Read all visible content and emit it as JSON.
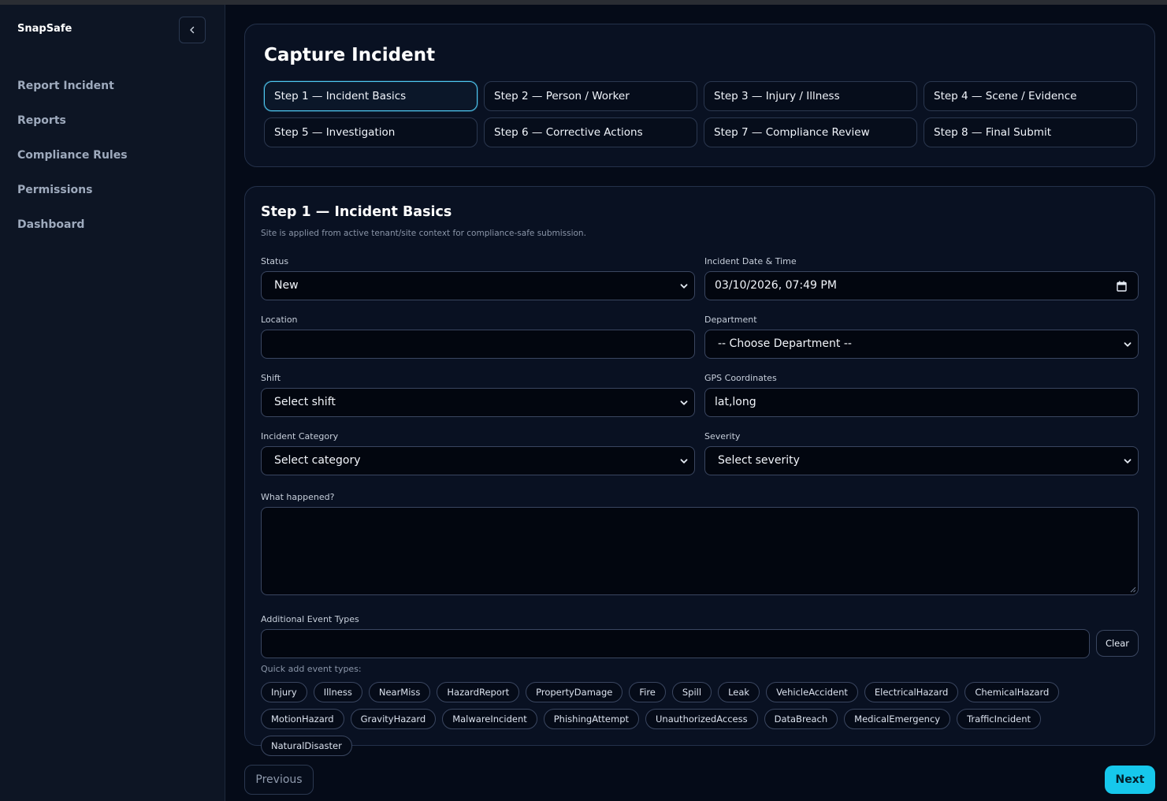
{
  "app": {
    "name": "SnapSafe"
  },
  "sidebar": {
    "items": [
      {
        "label": "Report Incident"
      },
      {
        "label": "Reports"
      },
      {
        "label": "Compliance Rules"
      },
      {
        "label": "Permissions"
      },
      {
        "label": "Dashboard"
      }
    ]
  },
  "page": {
    "title": "Capture Incident"
  },
  "steps": [
    {
      "label": "Step 1 — Incident Basics",
      "active": true
    },
    {
      "label": "Step 2 — Person / Worker"
    },
    {
      "label": "Step 3 — Injury / Illness"
    },
    {
      "label": "Step 4 — Scene / Evidence"
    },
    {
      "label": "Step 5 — Investigation"
    },
    {
      "label": "Step 6 — Corrective Actions"
    },
    {
      "label": "Step 7 — Compliance Review"
    },
    {
      "label": "Step 8 — Final Submit"
    }
  ],
  "form": {
    "title": "Step 1 — Incident Basics",
    "subtitle": "Site is applied from active tenant/site context for compliance-safe submission.",
    "status": {
      "label": "Status",
      "value": "New"
    },
    "datetime": {
      "label": "Incident Date & Time",
      "value": "03/10/2026, 07:49 PM"
    },
    "location": {
      "label": "Location",
      "value": ""
    },
    "department": {
      "label": "Department",
      "value": "-- Choose Department --"
    },
    "shift": {
      "label": "Shift",
      "value": "Select shift"
    },
    "gps": {
      "label": "GPS Coordinates",
      "placeholder": "lat,long"
    },
    "category": {
      "label": "Incident Category",
      "value": "Select category"
    },
    "severity": {
      "label": "Severity",
      "value": "Select severity"
    },
    "what_happened": {
      "label": "What happened?",
      "value": ""
    },
    "additional": {
      "label": "Additional Event Types",
      "clear_label": "Clear"
    },
    "quick_add_label": "Quick add event types:",
    "quick_add": [
      "Injury",
      "Illness",
      "NearMiss",
      "HazardReport",
      "PropertyDamage",
      "Fire",
      "Spill",
      "Leak",
      "VehicleAccident",
      "ElectricalHazard",
      "ChemicalHazard",
      "MotionHazard",
      "GravityHazard",
      "MalwareIncident",
      "PhishingAttempt",
      "UnauthorizedAccess",
      "DataBreach",
      "MedicalEmergency",
      "TrafficIncident",
      "NaturalDisaster"
    ]
  },
  "footer": {
    "previous_label": "Previous",
    "next_label": "Next"
  },
  "colors": {
    "accent": "#16c8ec",
    "active_border": "#4fc9f2",
    "background": "#050b18",
    "sidebar": "#0d1524"
  },
  "icons": {
    "collapse": "chevron-left-icon",
    "select": "chevron-down-icon",
    "calendar": "calendar-icon"
  }
}
